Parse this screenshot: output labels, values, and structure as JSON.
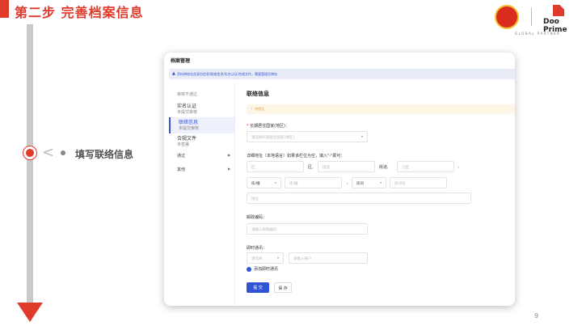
{
  "slide": {
    "title": "第二步  完善档案信息",
    "step_label": "填写联络信息",
    "page_number": "9"
  },
  "brand": {
    "partner_name": "Doo Prime",
    "partner_tagline": "GLOBAL PARTNER",
    "accent": "#e03a2b"
  },
  "app": {
    "header": "档案管理",
    "banner": "资料审核包含身份信息/联络信息/实名认证/合规文件，需要管理员审核",
    "sidebar": {
      "status_heading": "审核不通过",
      "items": [
        {
          "label": "实名认证",
          "sub": "未提交审核"
        },
        {
          "label": "联络信息",
          "sub": "未提交审核"
        },
        {
          "label": "合规文件",
          "sub": "未签署"
        }
      ],
      "groups": [
        {
          "label": "通过"
        },
        {
          "label": "其他"
        }
      ]
    },
    "form": {
      "title": "联络信息",
      "status": "待提交",
      "country_label": "长期居住国家(地区)：",
      "country_placeholder": "请选择长期居住国家(地区)",
      "address_label": "详细地址（本地语言）如果该栏位为空，填入\"-\"即可：",
      "district_placeholder": "区",
      "district_suffix": "区,",
      "street_placeholder": "街道",
      "street_suffix": "街道,",
      "community_placeholder": "小区",
      "comma": ",",
      "building_select": "栋/幢",
      "building_placeholder": "栋/幢",
      "room_select": "房间",
      "room_placeholder": "房间号",
      "address_placeholder": "地址",
      "postal_label": "邮政编码：",
      "postal_placeholder": "请输入邮政编码",
      "im_label": "即时通讯：",
      "im_select_placeholder": "请选择",
      "im_account_placeholder": "请输入账户",
      "add_im": "添加即时通讯",
      "submit": "提 交",
      "save": "保 存"
    }
  }
}
